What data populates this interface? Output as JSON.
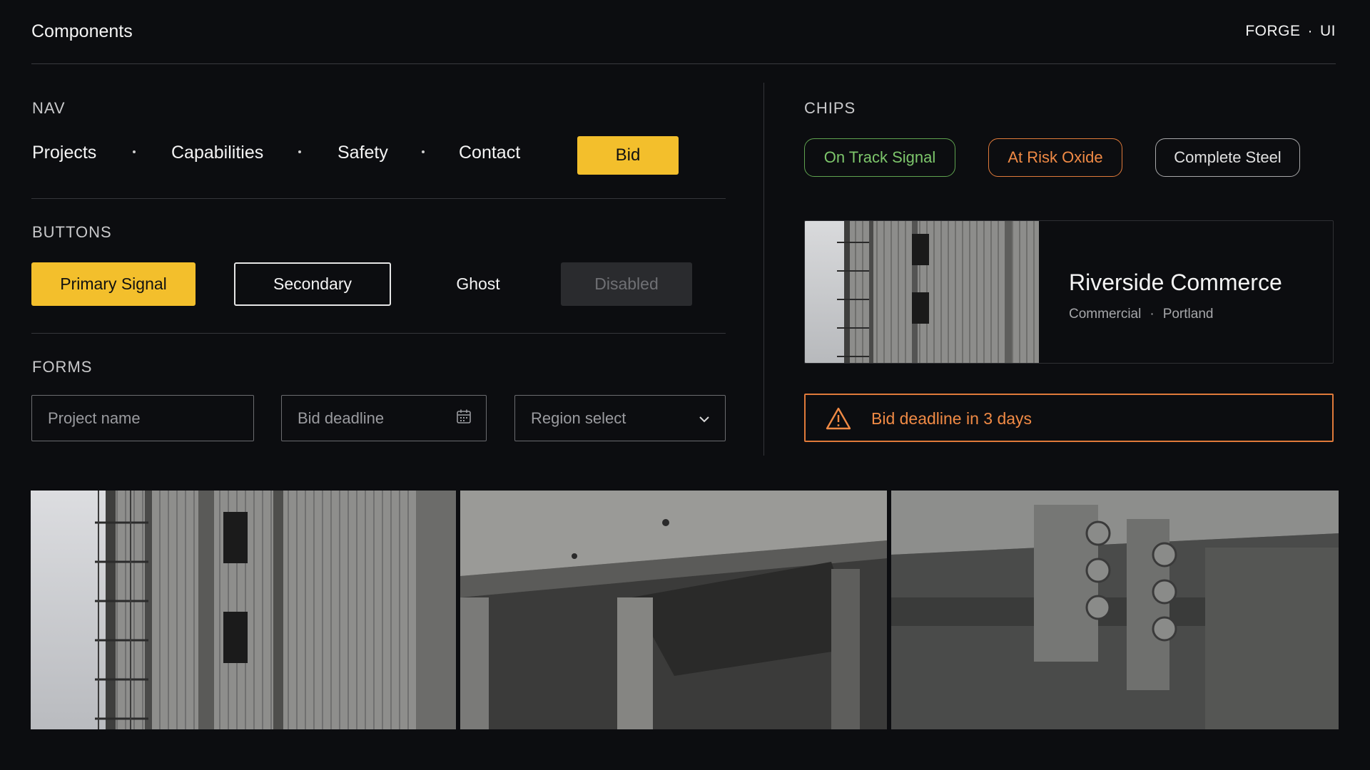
{
  "header": {
    "title": "Components",
    "brand_name": "FORGE",
    "brand_sep": "·",
    "brand_suffix": "UI"
  },
  "sections": {
    "nav": "NAV",
    "buttons": "BUTTONS",
    "forms": "FORMS",
    "chips": "CHIPS"
  },
  "nav": {
    "items": [
      "Projects",
      "Capabilities",
      "Safety",
      "Contact"
    ],
    "cta": "Bid"
  },
  "buttons": {
    "primary": "Primary Signal",
    "secondary": "Secondary",
    "ghost": "Ghost",
    "disabled": "Disabled"
  },
  "forms": {
    "project_name_placeholder": "Project name",
    "bid_deadline_placeholder": "Bid deadline",
    "region_select_value": "Region select"
  },
  "chips": [
    {
      "label": "On Track Signal",
      "color": "#7dc66b"
    },
    {
      "label": "At Risk Oxide",
      "color": "#f08a45"
    },
    {
      "label": "Complete Steel",
      "color": "#e0e0e0"
    }
  ],
  "card": {
    "title": "Riverside Commerce",
    "category": "Commercial",
    "sep": "·",
    "location": "Portland"
  },
  "alert": {
    "text": "Bid deadline in 3 days",
    "icon": "warning-icon",
    "color": "#e07a3a"
  },
  "colors": {
    "accent": "#f3bf2c",
    "background": "#0c0d10"
  }
}
